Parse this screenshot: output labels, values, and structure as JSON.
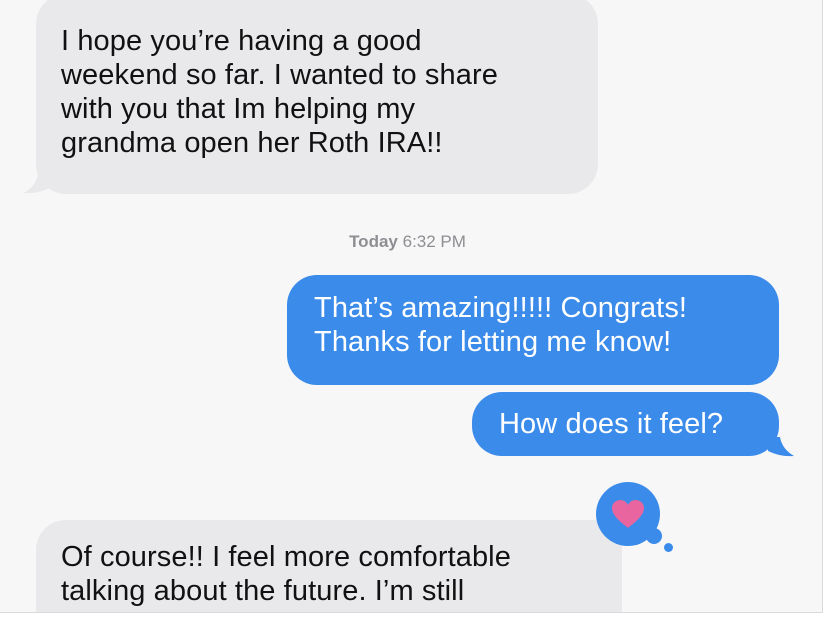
{
  "conversation": {
    "messages": [
      {
        "direction": "incoming",
        "lines": [
          "I hope you’re having a good",
          "weekend so far. I wanted to share",
          "with you that Im helping my",
          "grandma open her Roth IRA!!"
        ]
      },
      {
        "direction": "outgoing",
        "lines": [
          "That’s amazing!!!!! Congrats!",
          "Thanks for letting me know!"
        ]
      },
      {
        "direction": "outgoing",
        "lines": [
          "How does it feel?"
        ]
      },
      {
        "direction": "incoming",
        "lines": [
          "Of course!! I feel more comfortable",
          "talking about the future. I’m still"
        ]
      }
    ],
    "timestamp": {
      "day": "Today",
      "time": "6:32 PM"
    },
    "reaction": {
      "icon": "heart-icon",
      "color": "#e8659f",
      "background": "#3b8beb"
    }
  },
  "colors": {
    "incoming_bubble": "#e9e9eb",
    "outgoing_bubble": "#3b8beb",
    "background": "#f7f7f8"
  }
}
